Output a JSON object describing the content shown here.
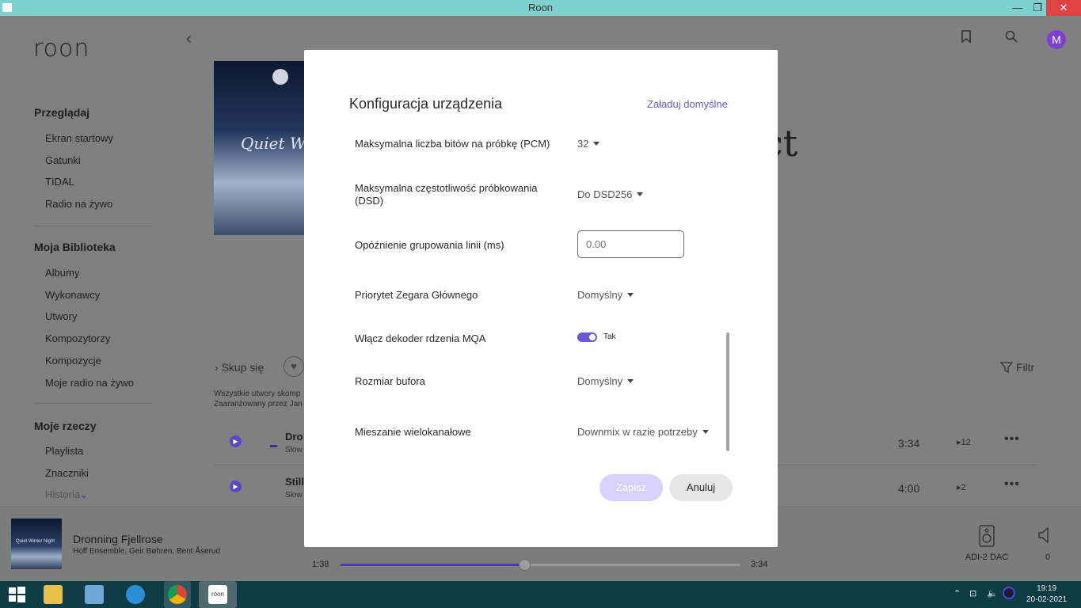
{
  "window": {
    "title": "Roon"
  },
  "sidebar": {
    "logo": "roon",
    "browse_title": "Przeglądaj",
    "browse_items": [
      "Ekran startowy",
      "Gatunki",
      "TIDAL",
      "Radio na żywo"
    ],
    "library_title": "Moja Biblioteka",
    "library_items": [
      "Albumy",
      "Wykonawcy",
      "Utwory",
      "Kompozytorzy",
      "Kompozycje",
      "Moje radio na żywo"
    ],
    "stuff_title": "Moje rzeczy",
    "stuff_items": [
      "Playlista",
      "Znaczniki",
      "Historia"
    ]
  },
  "main": {
    "album_cover_text": "Quiet Win",
    "album_title_partial": "ct",
    "focus_label": "Skup się",
    "filter_label": "Filtr",
    "credits_line1": "Wszystkie utwory skomp",
    "credits_line2": "Zaaranżowany przez Jan",
    "tracks": [
      {
        "name": "Dro",
        "sub": "Słow",
        "duration": "3:34",
        "plays": "▸12"
      },
      {
        "name": "Still",
        "sub": "Słow",
        "duration": "4:00",
        "plays": "▸2"
      }
    ]
  },
  "modal": {
    "title": "Konfiguracja urządzenia",
    "load_defaults": "Załaduj domyślne",
    "settings": [
      {
        "label": "Maksymalna liczba bitów na próbkę (PCM)",
        "value": "32"
      },
      {
        "label": "Maksymalna częstotliwość próbkowania (DSD)",
        "value": "Do DSD256"
      },
      {
        "label": "Opóźnienie grupowania linii (ms)",
        "placeholder": "0.00"
      },
      {
        "label": "Priorytet Zegara Głównego",
        "value": "Domyślny"
      },
      {
        "label": "Włącz dekoder rdzenia MQA",
        "value": "Tak"
      },
      {
        "label": "Rozmiar bufora",
        "value": "Domyślny"
      },
      {
        "label": "Mieszanie wielokanałowe",
        "value": "Downmix w razie potrzeby"
      }
    ],
    "save": "Zapisz",
    "cancel": "Anuluj",
    "accent_color": "#6a58d8"
  },
  "player": {
    "cover_text": "Quiet Winter Night",
    "track": "Dronning Fjellrose",
    "artists": "Hoff Ensemble, Geir Bøhren, Bent Åserud",
    "elapsed": "1:38",
    "total": "3:34",
    "progress": 0.46,
    "device": "ADI-2 DAC",
    "volume": "0"
  },
  "taskbar": {
    "clock_time": "19:19",
    "clock_date": "20-02-2021"
  }
}
